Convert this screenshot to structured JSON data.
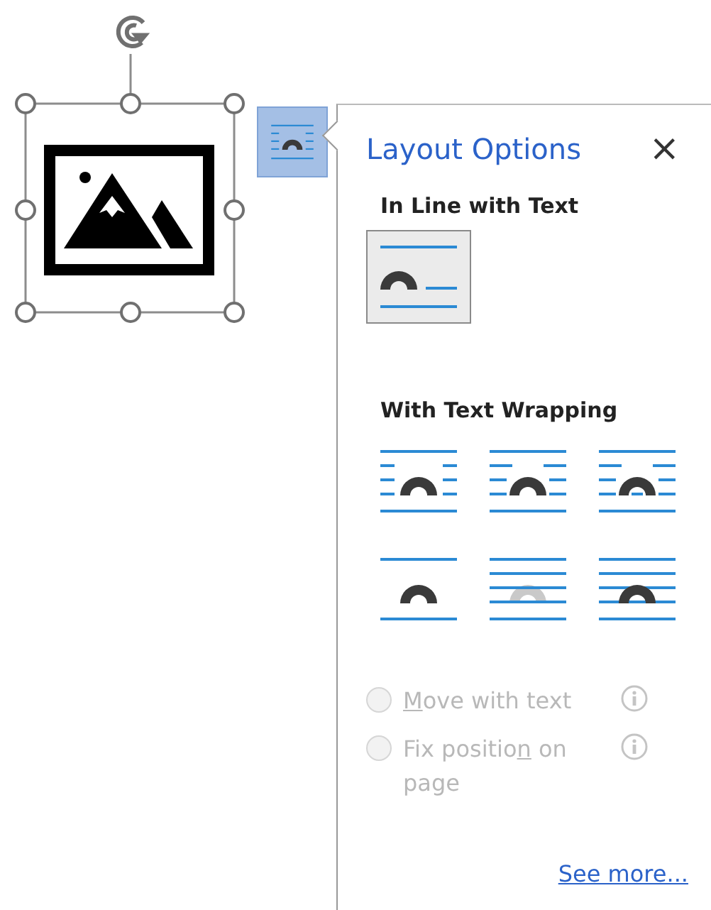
{
  "layout_button": {
    "selected": true
  },
  "panel": {
    "title": "Layout Options",
    "close": "×"
  },
  "sections": [
    {
      "heading": "In Line with Text",
      "options": [
        {
          "kind": "inline",
          "selected": true
        }
      ]
    },
    {
      "heading": "With Text Wrapping",
      "options": [
        {
          "kind": "square",
          "selected": false
        },
        {
          "kind": "tight",
          "selected": false
        },
        {
          "kind": "through",
          "selected": false
        },
        {
          "kind": "topbottom",
          "selected": false
        },
        {
          "kind": "behind",
          "selected": false
        },
        {
          "kind": "front",
          "selected": false
        }
      ]
    }
  ],
  "radios": [
    {
      "key": "M",
      "after": "ove with text",
      "selected": false,
      "disabled": true
    },
    {
      "before": "Fix positio",
      "key": "n",
      "after": " on page",
      "selected": false,
      "disabled": true
    }
  ],
  "link": "See more..."
}
